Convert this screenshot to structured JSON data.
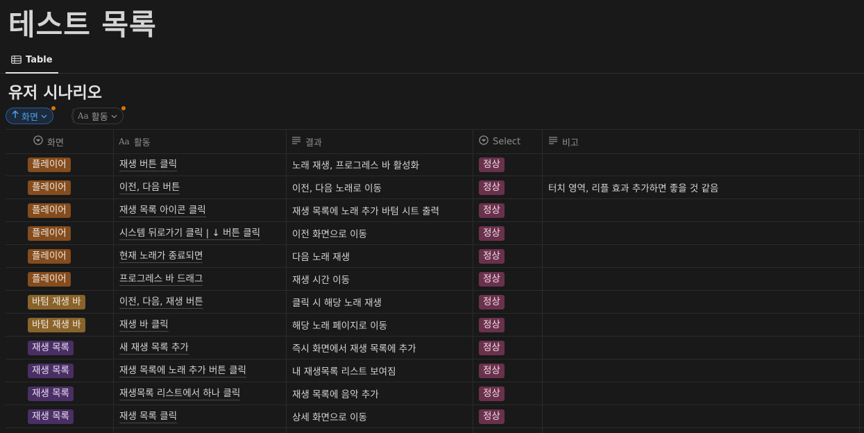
{
  "page": {
    "title": "테스트 목록"
  },
  "view_tabs": [
    {
      "label": "Table",
      "icon": "table-icon"
    }
  ],
  "database": {
    "title": "유저 시나리오"
  },
  "filters": {
    "sort_chip": {
      "label": "화면",
      "icon": "arrow-up-icon"
    },
    "property_chip": {
      "prefix": "Aa",
      "label": "활동"
    }
  },
  "columns": [
    {
      "label": "화면",
      "icon": "select-icon"
    },
    {
      "label": "활동",
      "icon": "title-aa-icon"
    },
    {
      "label": "결과",
      "icon": "text-lines-icon"
    },
    {
      "label": "Select",
      "icon": "select-icon"
    },
    {
      "label": "비고",
      "icon": "text-lines-icon"
    }
  ],
  "colors": {
    "tag_player": "#854c1d",
    "tag_bottom_bar": "#89632a",
    "tag_playlist": "#492f64",
    "tag_normal": "#69314c",
    "background": "#191919"
  },
  "rows": [
    {
      "screen": "플레이어",
      "screen_type": "player",
      "activity": "재생 버튼 클릭",
      "result": "노래 재생, 프로그레스 바 활성화",
      "select": "정상",
      "note": ""
    },
    {
      "screen": "플레이어",
      "screen_type": "player",
      "activity": "이전, 다음 버튼",
      "result": "이전, 다음 노래로 이동",
      "select": "정상",
      "note": "터치 영역, 리플 효과 추가하면 좋을 것 같음"
    },
    {
      "screen": "플레이어",
      "screen_type": "player",
      "activity": "재생 목록 아이콘 클릭",
      "result": "재생 목록에 노래 추가 바텀 시트 출력",
      "select": "정상",
      "note": ""
    },
    {
      "screen": "플레이어",
      "screen_type": "player",
      "activity": "시스템 뒤로가기 클릭 | ↓ 버튼 클릭",
      "result": "이전 화면으로 이동",
      "select": "정상",
      "note": ""
    },
    {
      "screen": "플레이어",
      "screen_type": "player",
      "activity": "현재 노래가 종료되면",
      "result": "다음 노래 재생",
      "select": "정상",
      "note": ""
    },
    {
      "screen": "플레이어",
      "screen_type": "player",
      "activity": "프로그레스 바 드래그",
      "result": "재생 시간 이동",
      "select": "정상",
      "note": ""
    },
    {
      "screen": "바텀 재생 바",
      "screen_type": "bottom",
      "activity": "이전, 다음, 재생 버튼",
      "result": "클릭 시 해당 노래 재생",
      "select": "정상",
      "note": ""
    },
    {
      "screen": "바텀 재생 바",
      "screen_type": "bottom",
      "activity": "재생 바 클릭",
      "result": "해당 노래 페이지로 이동",
      "select": "정상",
      "note": ""
    },
    {
      "screen": "재생 목록",
      "screen_type": "list",
      "activity": "새 재생 목록 추가",
      "result": "즉시 화면에서 재생 목록에 추가",
      "select": "정상",
      "note": ""
    },
    {
      "screen": "재생 목록",
      "screen_type": "list",
      "activity": "재생 목록에 노래 추가 버튼 클릭",
      "result": "내 재생목록 리스트 보여짐",
      "select": "정상",
      "note": ""
    },
    {
      "screen": "재생 목록",
      "screen_type": "list",
      "activity": "재생목록 리스트에서 하나 클릭",
      "result": "재생 목록에 음악 추가",
      "select": "정상",
      "note": ""
    },
    {
      "screen": "재생 목록",
      "screen_type": "list",
      "activity": "재생 목록 클릭",
      "result": "상세 화면으로 이동",
      "select": "정상",
      "note": ""
    }
  ]
}
